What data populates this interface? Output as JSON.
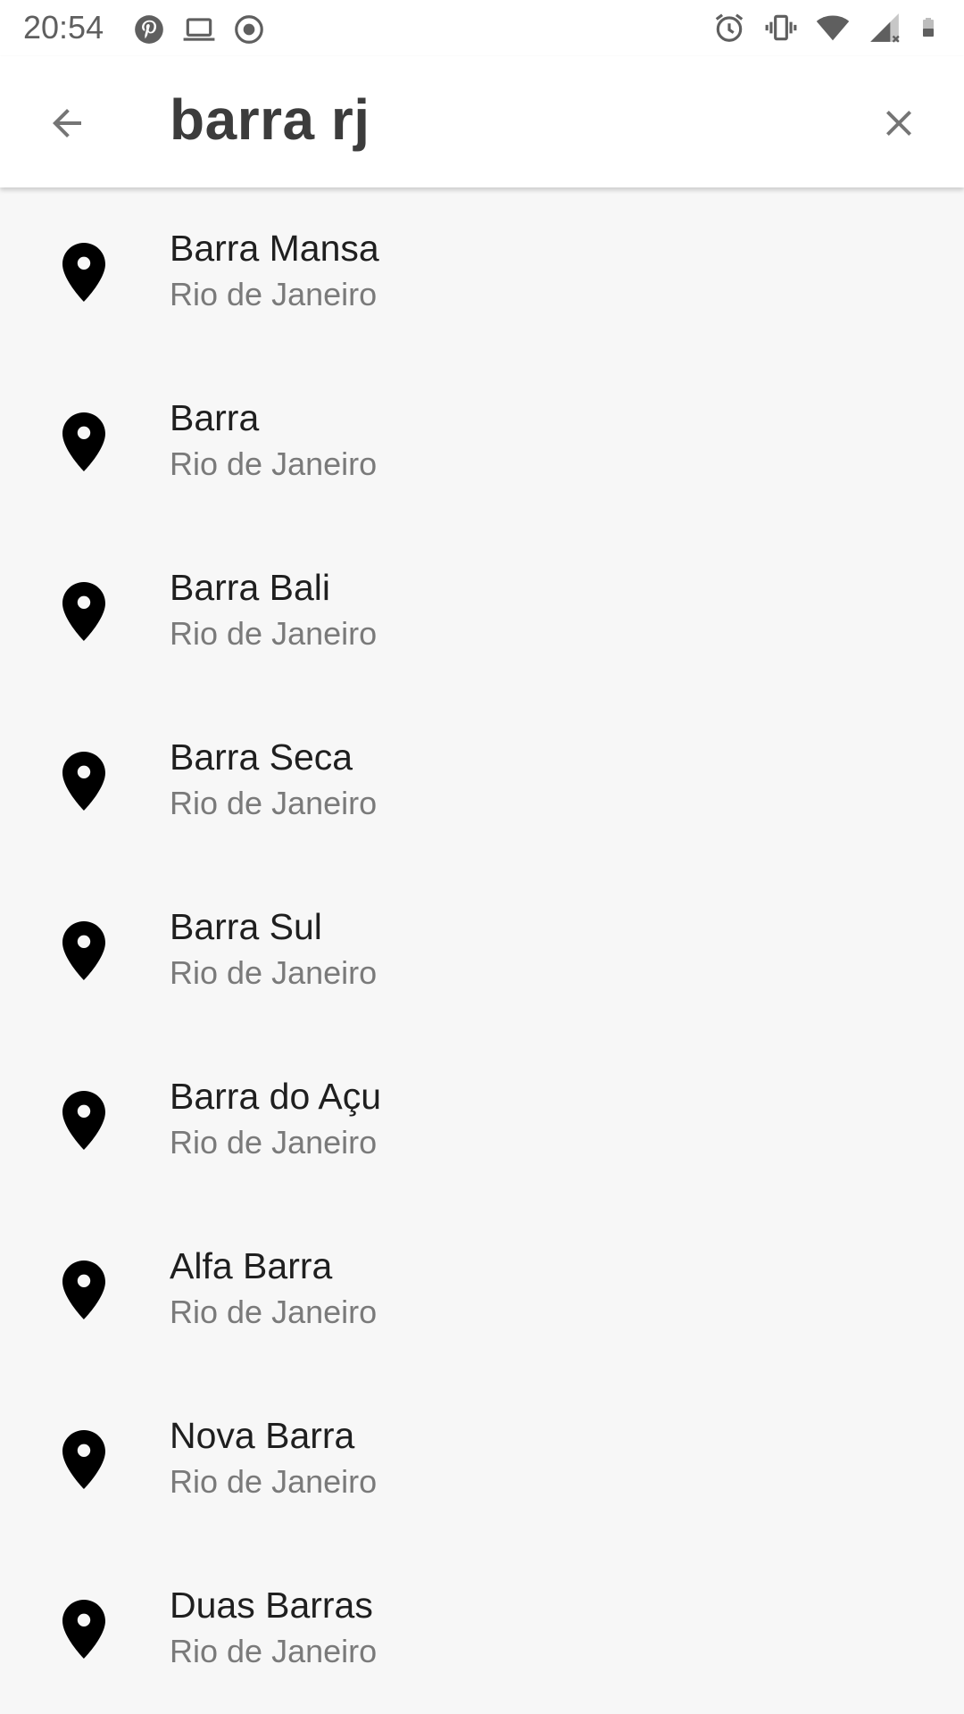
{
  "status_bar": {
    "time": "20:54",
    "left_icons": [
      "pinterest-icon",
      "laptop-icon",
      "record-icon"
    ],
    "right_icons": [
      "alarm-icon",
      "vibrate-icon",
      "wifi-icon",
      "signal-icon",
      "battery-icon"
    ]
  },
  "search": {
    "query": "barra rj",
    "back_icon": "arrow-back-icon",
    "clear_icon": "close-icon"
  },
  "results": [
    {
      "title": "Barra Mansa",
      "subtitle": "Rio de Janeiro"
    },
    {
      "title": "Barra",
      "subtitle": "Rio de Janeiro"
    },
    {
      "title": "Barra Bali",
      "subtitle": "Rio de Janeiro"
    },
    {
      "title": "Barra Seca",
      "subtitle": "Rio de Janeiro"
    },
    {
      "title": "Barra Sul",
      "subtitle": "Rio de Janeiro"
    },
    {
      "title": "Barra do Açu",
      "subtitle": "Rio de Janeiro"
    },
    {
      "title": "Alfa Barra",
      "subtitle": "Rio de Janeiro"
    },
    {
      "title": "Nova Barra",
      "subtitle": "Rio de Janeiro"
    },
    {
      "title": "Duas Barras",
      "subtitle": "Rio de Janeiro"
    }
  ],
  "colors": {
    "background": "#f7f7f7",
    "bar": "#ffffff",
    "title_text": "#1f1f1f",
    "subtitle_text": "#7a7a7a",
    "icon_gray": "#757575"
  }
}
